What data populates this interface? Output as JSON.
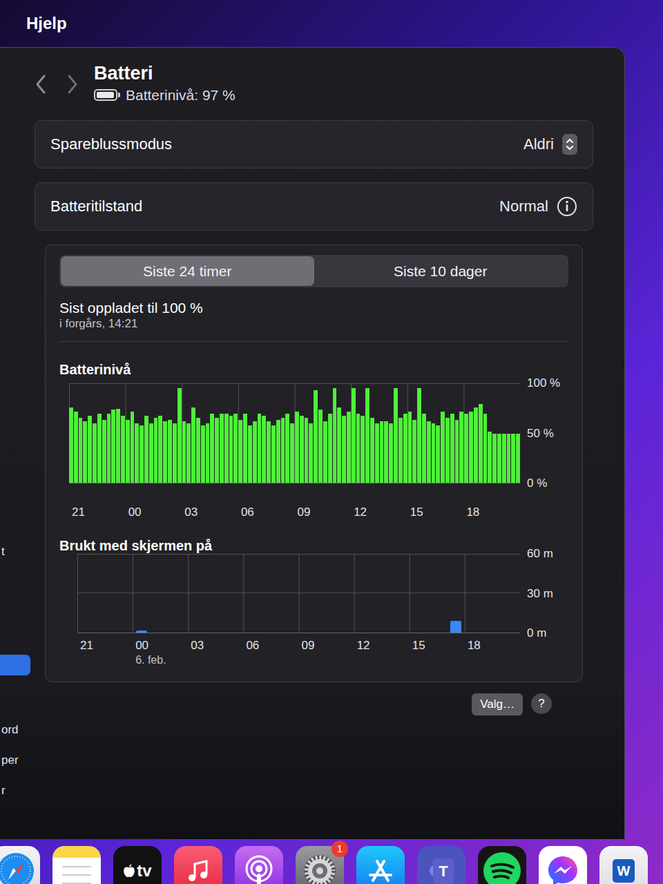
{
  "menu_bar": {
    "items": [
      "Hjelp"
    ]
  },
  "header": {
    "title": "Batteri",
    "subtitle": "Batterinivå: 97 %",
    "battery_level": 0.97
  },
  "settings_rows": [
    {
      "label": "Spareblussmodus",
      "value": "Aldri",
      "kind": "popup"
    },
    {
      "label": "Batteritilstand",
      "value": "Normal",
      "kind": "info"
    }
  ],
  "tabs": [
    {
      "label": "Siste 24 timer",
      "selected": true
    },
    {
      "label": "Siste 10 dager",
      "selected": false
    }
  ],
  "last_charged": {
    "title": "Sist oppladet til 100 %",
    "time": "i forgårs, 14:21"
  },
  "battery_chart": {
    "title": "Batterinivå",
    "y_ticks": [
      "100 %",
      "50 %",
      "0 %"
    ],
    "x_ticks": [
      {
        "label": "21"
      },
      {
        "label": "00"
      },
      {
        "label": "03"
      },
      {
        "label": "06"
      },
      {
        "label": "09"
      },
      {
        "label": "12"
      },
      {
        "label": "15"
      },
      {
        "label": "18"
      }
    ],
    "values": [
      76,
      72,
      66,
      62,
      68,
      60,
      70,
      64,
      70,
      74,
      75,
      68,
      64,
      72,
      60,
      58,
      68,
      60,
      66,
      68,
      62,
      64,
      60,
      96,
      62,
      60,
      76,
      66,
      58,
      60,
      70,
      66,
      70,
      70,
      68,
      70,
      64,
      70,
      58,
      62,
      70,
      68,
      62,
      58,
      64,
      66,
      70,
      60,
      72,
      68,
      66,
      60,
      94,
      74,
      62,
      70,
      96,
      76,
      68,
      72,
      96,
      70,
      68,
      96,
      66,
      60,
      62,
      62,
      60,
      96,
      66,
      70,
      72,
      64,
      96,
      70,
      62,
      60,
      58,
      72,
      66,
      70,
      64,
      72,
      70,
      72,
      76,
      80,
      70,
      52,
      50,
      50,
      50,
      50,
      50,
      50
    ]
  },
  "screen_chart": {
    "title": "Brukt med skjermen på",
    "y_ticks": [
      "60 m",
      "30 m",
      "0 m"
    ],
    "x_ticks": [
      {
        "label": "21"
      },
      {
        "label": "00",
        "date": "6. feb."
      },
      {
        "label": "03"
      },
      {
        "label": "06"
      },
      {
        "label": "09"
      },
      {
        "label": "12"
      },
      {
        "label": "15"
      },
      {
        "label": "18"
      }
    ],
    "values": [
      0,
      0,
      0,
      1,
      0,
      0,
      0,
      0,
      0,
      0,
      0,
      0,
      0,
      0,
      0,
      0,
      0,
      0,
      0,
      0,
      9,
      0,
      0,
      0
    ]
  },
  "buttons": [
    "Valg…",
    "?"
  ],
  "sidebar": {
    "items": [
      {
        "label": "t",
        "selected": false
      },
      {
        "selected": true
      },
      {
        "label": "ord",
        "selected": false
      },
      {
        "label": "per",
        "selected": false
      },
      {
        "label": "r",
        "selected": false
      }
    ]
  },
  "dock": {
    "apps": [
      {
        "kind": "safari"
      },
      {
        "kind": "notes"
      },
      {
        "kind": "tv",
        "label": "tv"
      },
      {
        "kind": "music"
      },
      {
        "kind": "podcasts"
      },
      {
        "kind": "settings",
        "badge": "1"
      },
      {
        "kind": "appstore"
      },
      {
        "kind": "teams",
        "label": "T"
      },
      {
        "kind": "spotify"
      },
      {
        "kind": "messenger"
      },
      {
        "kind": "word",
        "label": "W"
      }
    ]
  }
}
